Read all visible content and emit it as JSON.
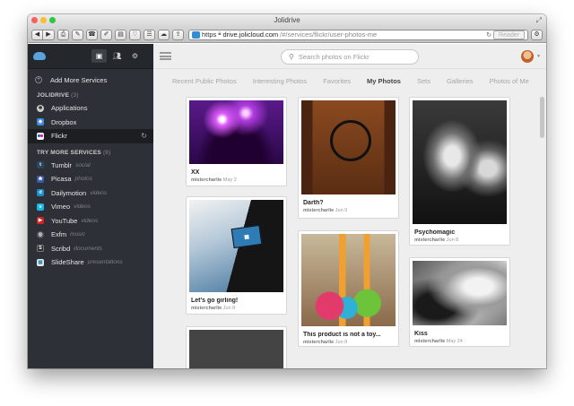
{
  "window": {
    "title": "Jolidrive"
  },
  "toolbar": {
    "url_scheme": "https",
    "url_host": "drive.jolicloud.com",
    "url_path": "/#/services/flickr/user-photos-me",
    "reader_label": "Reader"
  },
  "sidebar": {
    "add_more": "Add More Services",
    "jolidrive_heading": "JOLIDRIVE",
    "jolidrive_count": "(3)",
    "jolidrive_items": [
      {
        "label": "Applications",
        "icon": "applications-icon",
        "color": "#cfcfcf"
      },
      {
        "label": "Dropbox",
        "icon": "dropbox-icon",
        "color": "#3a8ee6"
      },
      {
        "label": "Flickr",
        "icon": "flickr-icon",
        "color": "#ff0084"
      }
    ],
    "more_heading": "TRY MORE SERVICES",
    "more_count": "(8)",
    "more_items": [
      {
        "label": "Tumblr",
        "sub": "social",
        "icon": "tumblr-icon",
        "color": "#2c4762"
      },
      {
        "label": "Picasa",
        "sub": "photos",
        "icon": "picasa-icon",
        "color": "#3b5ba8"
      },
      {
        "label": "Dailymotion",
        "sub": "videos",
        "icon": "dailymotion-icon",
        "color": "#1a8fd0"
      },
      {
        "label": "Vimeo",
        "sub": "videos",
        "icon": "vimeo-icon",
        "color": "#1ab7ea"
      },
      {
        "label": "YouTube",
        "sub": "videos",
        "icon": "youtube-icon",
        "color": "#d8201e"
      },
      {
        "label": "Exfm",
        "sub": "music",
        "icon": "exfm-icon",
        "color": "#555555"
      },
      {
        "label": "Scribd",
        "sub": "documents",
        "icon": "scribd-icon",
        "color": "#2a2a2a"
      },
      {
        "label": "SlideShare",
        "sub": "presentations",
        "icon": "slideshare-icon",
        "color": "#e9e9e9"
      }
    ]
  },
  "main": {
    "search_placeholder": "Search photos on Flickr",
    "tabs": [
      "Recent Public Photos",
      "Interesting Photos",
      "Favorites",
      "My Photos",
      "Sets",
      "Galleries",
      "Photos of Me"
    ],
    "active_tab": "My Photos",
    "photos": [
      {
        "title": "XX",
        "author": "mistercharlie",
        "date": "May 2"
      },
      {
        "title": "Let's go girling!",
        "author": "mistercharlie",
        "date": "Jun 8"
      },
      {
        "title": "Darth?",
        "author": "mistercharlie",
        "date": "Jun 9"
      },
      {
        "title": "This product is not a toy...",
        "author": "mistercharlie",
        "date": "Jun 8"
      },
      {
        "title": "Psychomagic",
        "author": "mistercharlie",
        "date": "Jun 8"
      },
      {
        "title": "Kiss",
        "author": "mistercharlie",
        "date": "May 24"
      }
    ]
  }
}
